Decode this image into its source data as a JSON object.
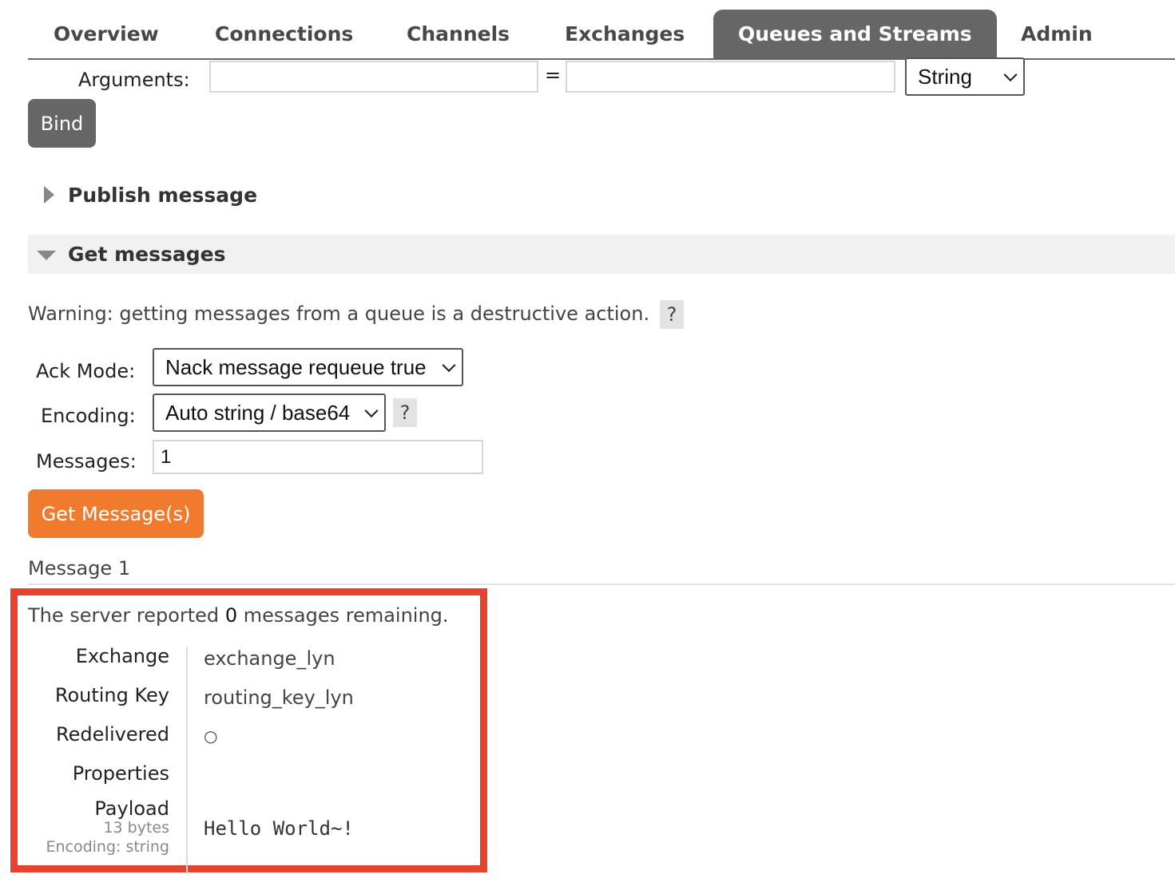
{
  "tabs": {
    "overview": "Overview",
    "connections": "Connections",
    "channels": "Channels",
    "exchanges": "Exchanges",
    "queues": "Queues and Streams",
    "admin": "Admin"
  },
  "bind_form": {
    "arguments_label": "Arguments:",
    "equals": "=",
    "arg_key_value": "",
    "arg_value_value": "",
    "type_selected": "String",
    "bind_button": "Bind"
  },
  "publish": {
    "title": "Publish message"
  },
  "get": {
    "title": "Get messages",
    "warning": "Warning: getting messages from a queue is a destructive action.",
    "help": "?",
    "ack_mode_label": "Ack Mode:",
    "ack_mode_selected": "Nack message requeue true",
    "encoding_label": "Encoding:",
    "encoding_selected": "Auto string / base64",
    "messages_label": "Messages:",
    "messages_value": "1",
    "get_button": "Get Message(s)"
  },
  "result": {
    "heading": "Message 1",
    "remaining_prefix": "The server reported",
    "remaining_count": "0",
    "remaining_suffix": "messages remaining.",
    "exchange_label": "Exchange",
    "exchange_value": "exchange_lyn",
    "routing_key_label": "Routing Key",
    "routing_key_value": "routing_key_lyn",
    "redelivered_label": "Redelivered",
    "redelivered_value": "○",
    "properties_label": "Properties",
    "payload_label": "Payload",
    "payload_size": "13 bytes",
    "payload_encoding": "Encoding: string",
    "payload_value": "Hello World~!"
  },
  "colors": {
    "accent_orange": "#f07a2e",
    "tab_active": "#666666",
    "highlight_border": "#e5432f"
  }
}
